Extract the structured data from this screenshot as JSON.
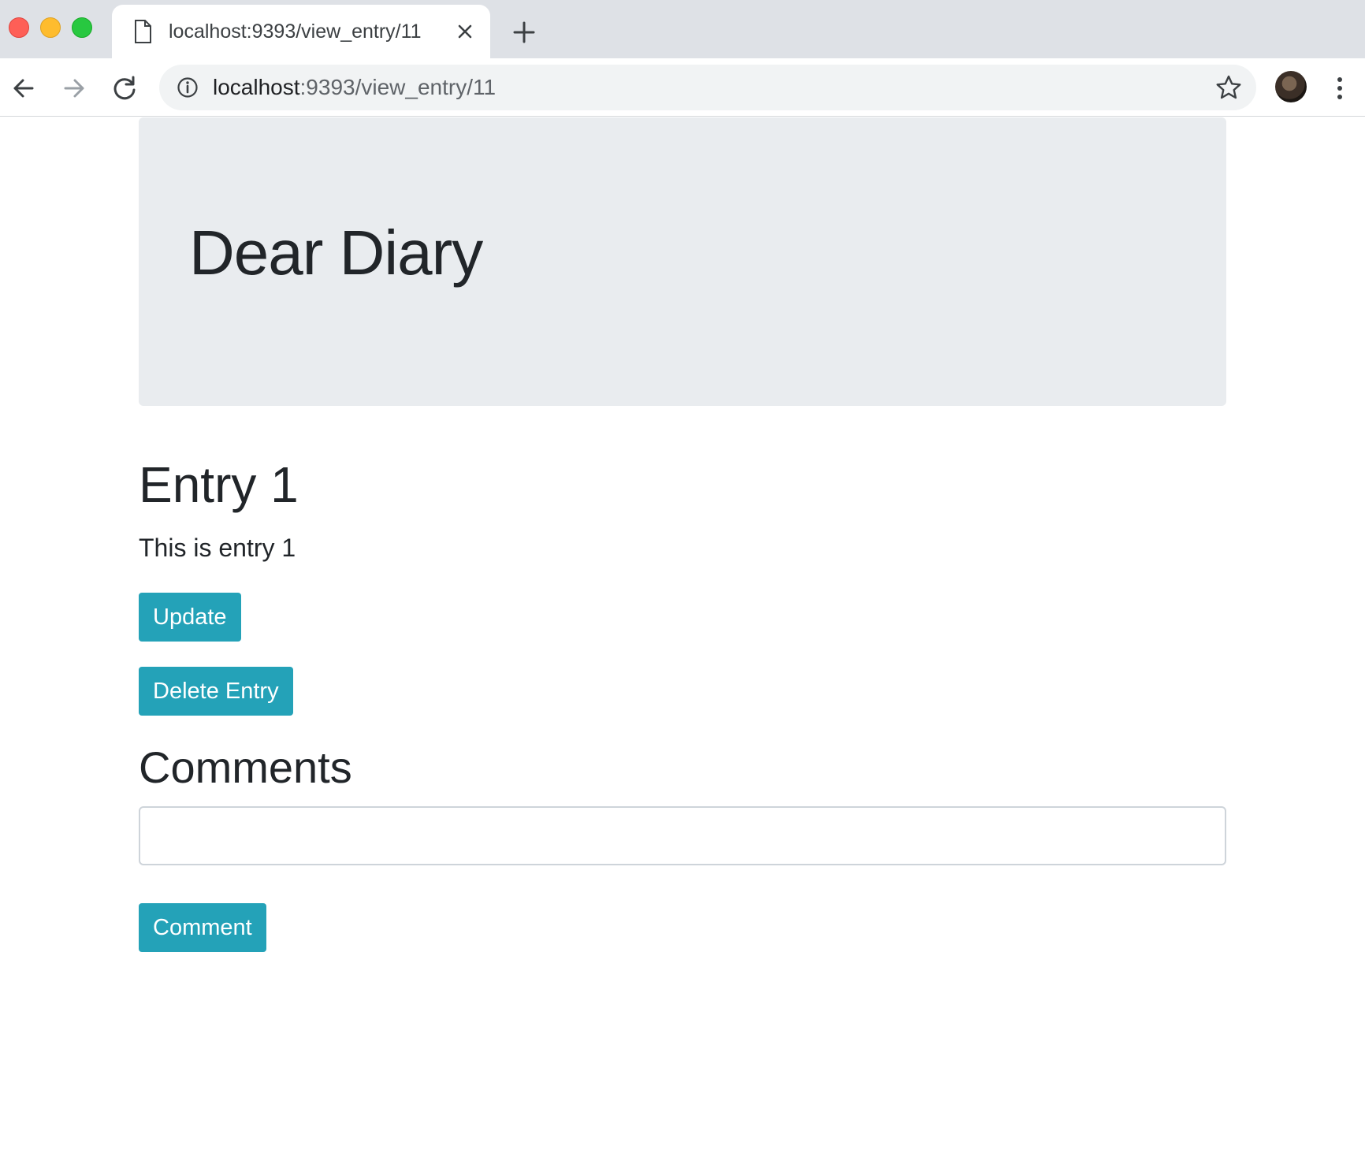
{
  "browser": {
    "tab": {
      "title": "localhost:9393/view_entry/11"
    },
    "address_bar": {
      "host": "localhost",
      "path": ":9393/view_entry/11"
    }
  },
  "page": {
    "jumbotron_title": "Dear Diary",
    "entry": {
      "title": "Entry 1",
      "body": "This is entry 1"
    },
    "buttons": {
      "update": "Update",
      "delete": "Delete Entry",
      "comment": "Comment"
    },
    "comments": {
      "heading": "Comments",
      "input_value": ""
    }
  },
  "colors": {
    "button": "#24a2b8",
    "jumbotron": "#e9ecef",
    "tabstrip": "#dee1e6"
  }
}
